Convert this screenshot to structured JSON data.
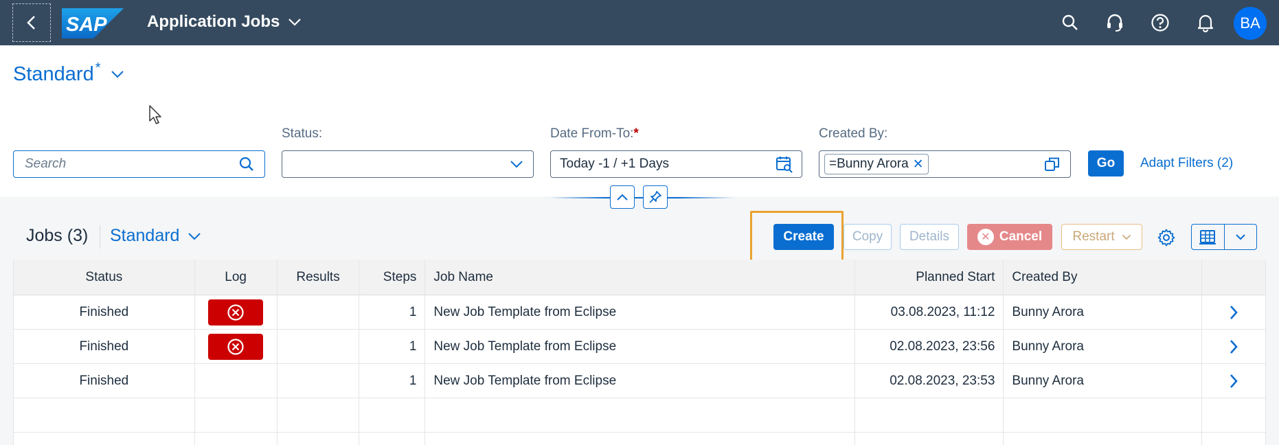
{
  "shell": {
    "app_title": "Application Jobs",
    "logo_text": "SAP",
    "avatar_initials": "BA",
    "colors": {
      "shell_bg": "#354a5f",
      "accent": "#0a6ed1",
      "avatar": "#0070f2"
    }
  },
  "filters": {
    "variant_name": "Standard",
    "variant_modified": "*",
    "search_placeholder": "Search",
    "status_label": "Status:",
    "status_value": "",
    "date_label": "Date From-To:",
    "date_required": "*",
    "date_value": "Today -1 / +1 Days",
    "created_by_label": "Created By:",
    "created_by_token": "=Bunny Arora",
    "go_label": "Go",
    "adapt_label": "Adapt Filters (2)"
  },
  "toolbar": {
    "jobs_title": "Jobs (3)",
    "table_variant": "Standard",
    "create_label": "Create",
    "copy_label": "Copy",
    "details_label": "Details",
    "cancel_label": "Cancel",
    "restart_label": "Restart"
  },
  "table": {
    "headers": {
      "status": "Status",
      "log": "Log",
      "results": "Results",
      "steps": "Steps",
      "job_name": "Job Name",
      "planned_start": "Planned Start",
      "created_by": "Created By"
    },
    "rows": [
      {
        "status": "Finished",
        "log_error": true,
        "results": "",
        "steps": "1",
        "job_name": "New Job Template from Eclipse",
        "planned_start": "03.08.2023, 11:12",
        "created_by": "Bunny Arora"
      },
      {
        "status": "Finished",
        "log_error": true,
        "results": "",
        "steps": "1",
        "job_name": "New Job Template from Eclipse",
        "planned_start": "02.08.2023, 23:56",
        "created_by": "Bunny Arora"
      },
      {
        "status": "Finished",
        "log_error": false,
        "results": "",
        "steps": "1",
        "job_name": "New Job Template from Eclipse",
        "planned_start": "02.08.2023, 23:53",
        "created_by": "Bunny Arora"
      }
    ]
  }
}
